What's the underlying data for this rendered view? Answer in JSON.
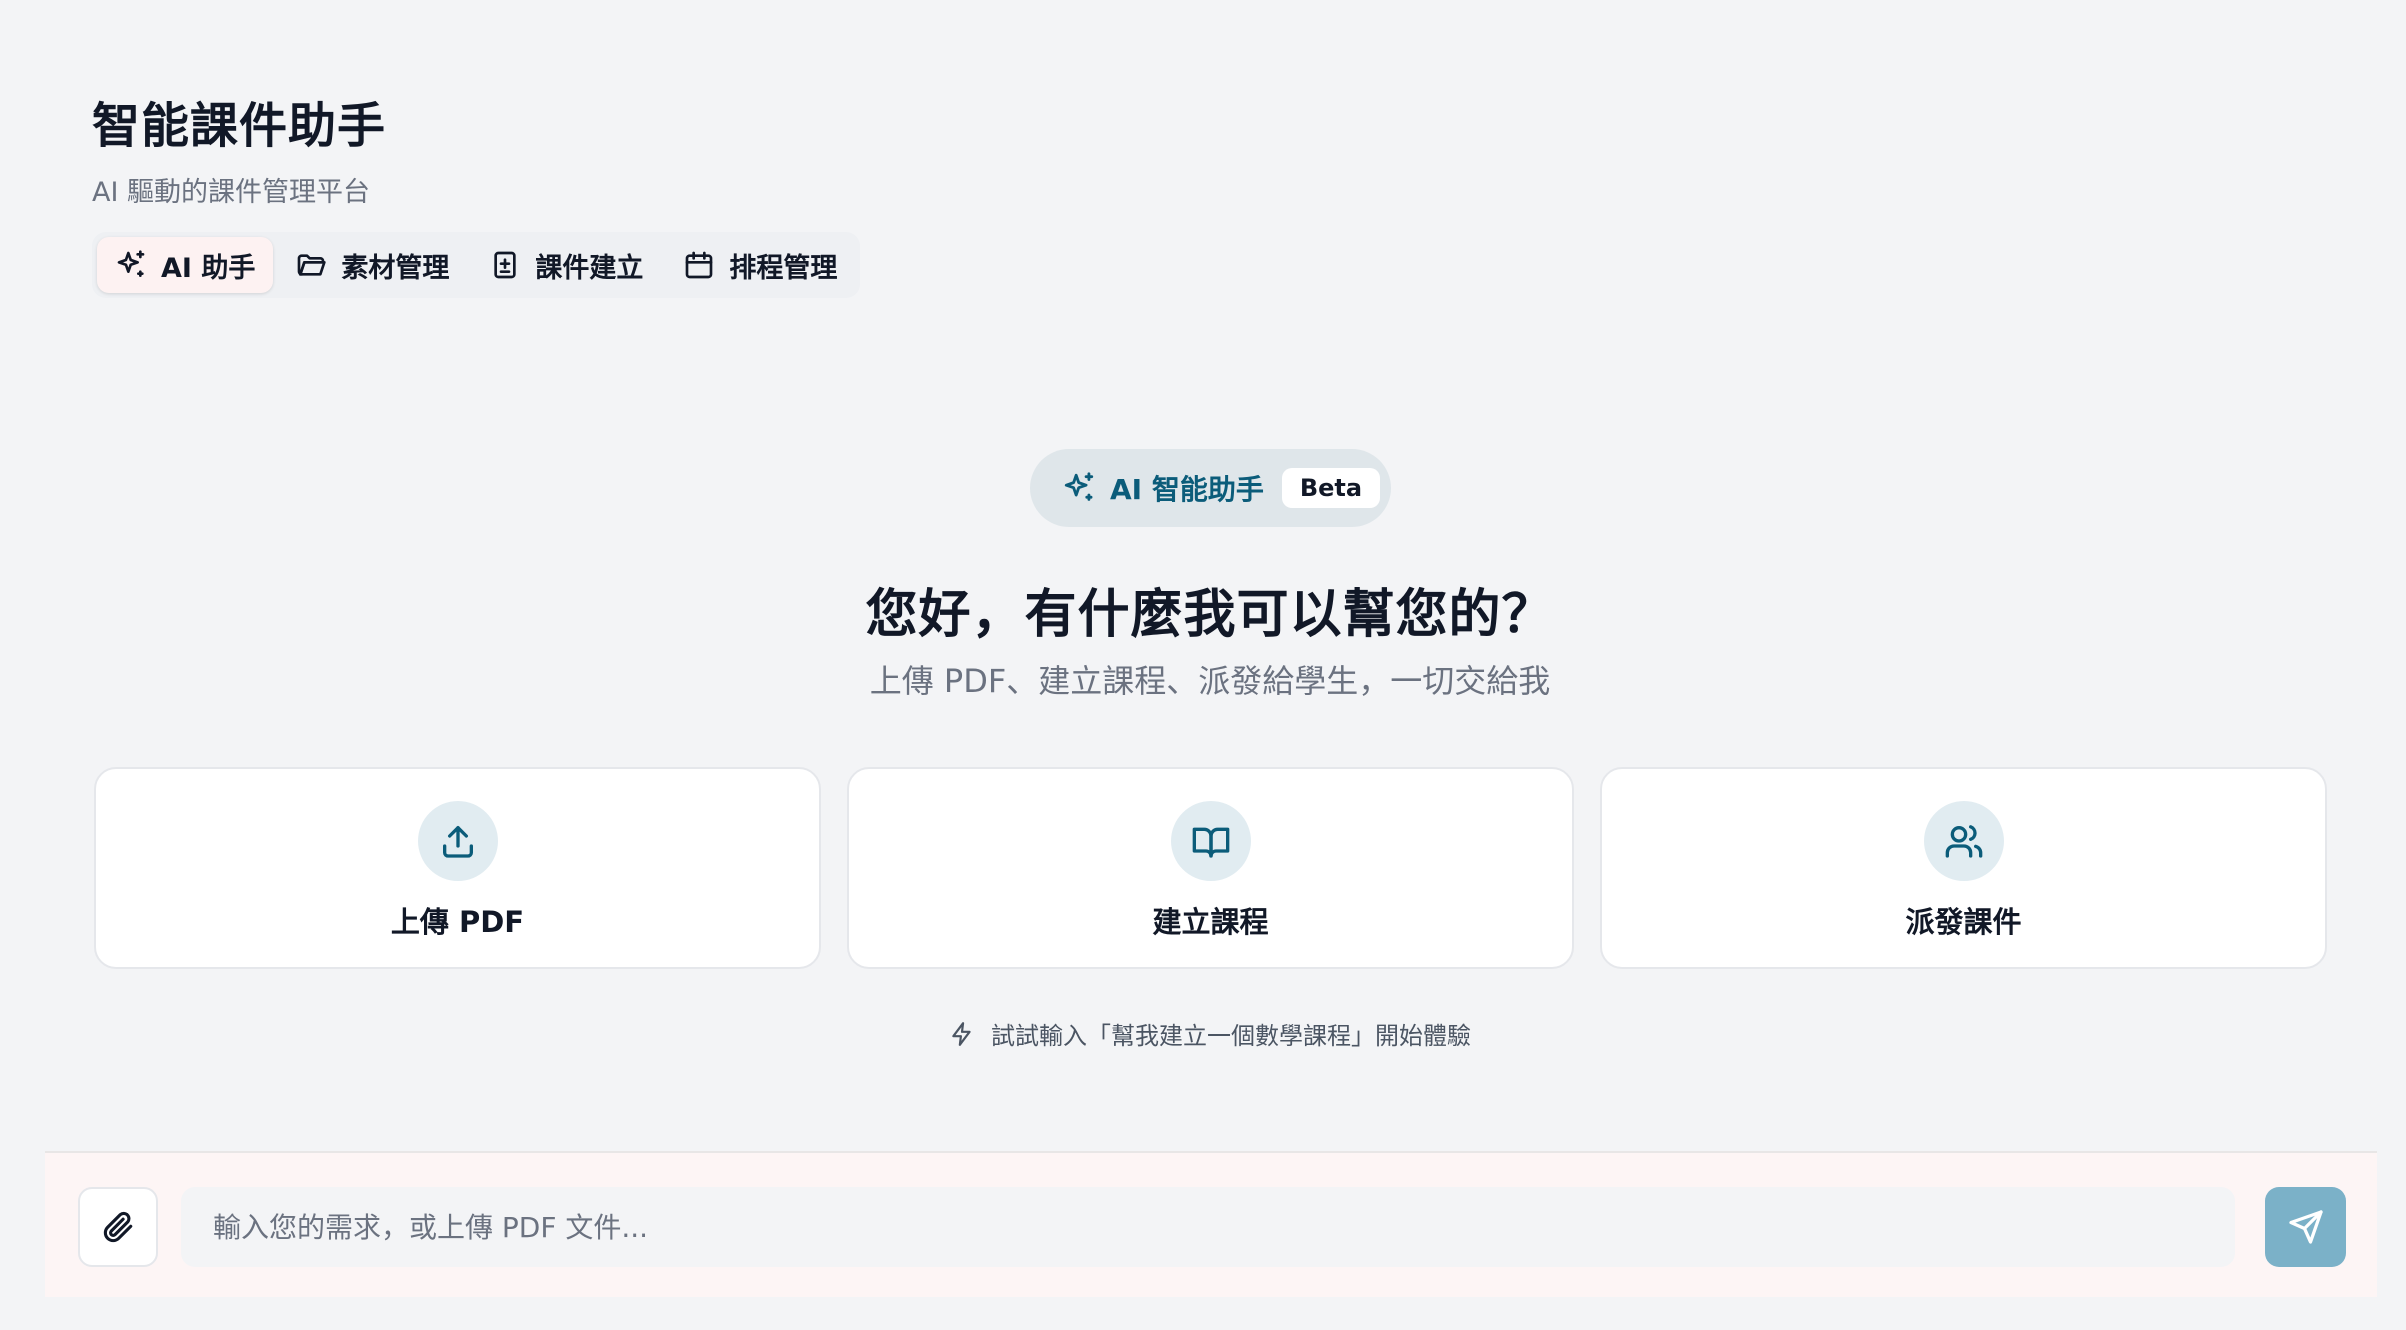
{
  "header": {
    "title": "智能課件助手",
    "subtitle": "AI 驅動的課件管理平台"
  },
  "tabs": [
    {
      "label": "AI 助手",
      "icon": "sparkles-icon",
      "active": true
    },
    {
      "label": "素材管理",
      "icon": "folder-icon",
      "active": false
    },
    {
      "label": "課件建立",
      "icon": "file-plus-icon",
      "active": false
    },
    {
      "label": "排程管理",
      "icon": "calendar-icon",
      "active": false
    }
  ],
  "hero": {
    "badge_label": "AI 智能助手",
    "badge_tag": "Beta",
    "greeting": "您好，有什麼我可以幫您的？",
    "subtitle": "上傳 PDF、建立課程、派發給學生，一切交給我"
  },
  "actions": [
    {
      "label": "上傳 PDF",
      "icon": "upload-icon"
    },
    {
      "label": "建立課程",
      "icon": "book-open-icon"
    },
    {
      "label": "派發課件",
      "icon": "users-icon"
    }
  ],
  "hint": {
    "text": "試試輸入「幫我建立一個數學課程」開始體驗",
    "icon": "lightning-icon"
  },
  "composer": {
    "placeholder": "輸入您的需求，或上傳 PDF 文件...",
    "value": "",
    "attach_icon": "paperclip-icon",
    "send_icon": "send-icon"
  },
  "colors": {
    "background": "#f3f4f6",
    "accent": "#0b5c7a",
    "send_button": "#7bb1c8",
    "active_tab": "#fdf2f2"
  }
}
